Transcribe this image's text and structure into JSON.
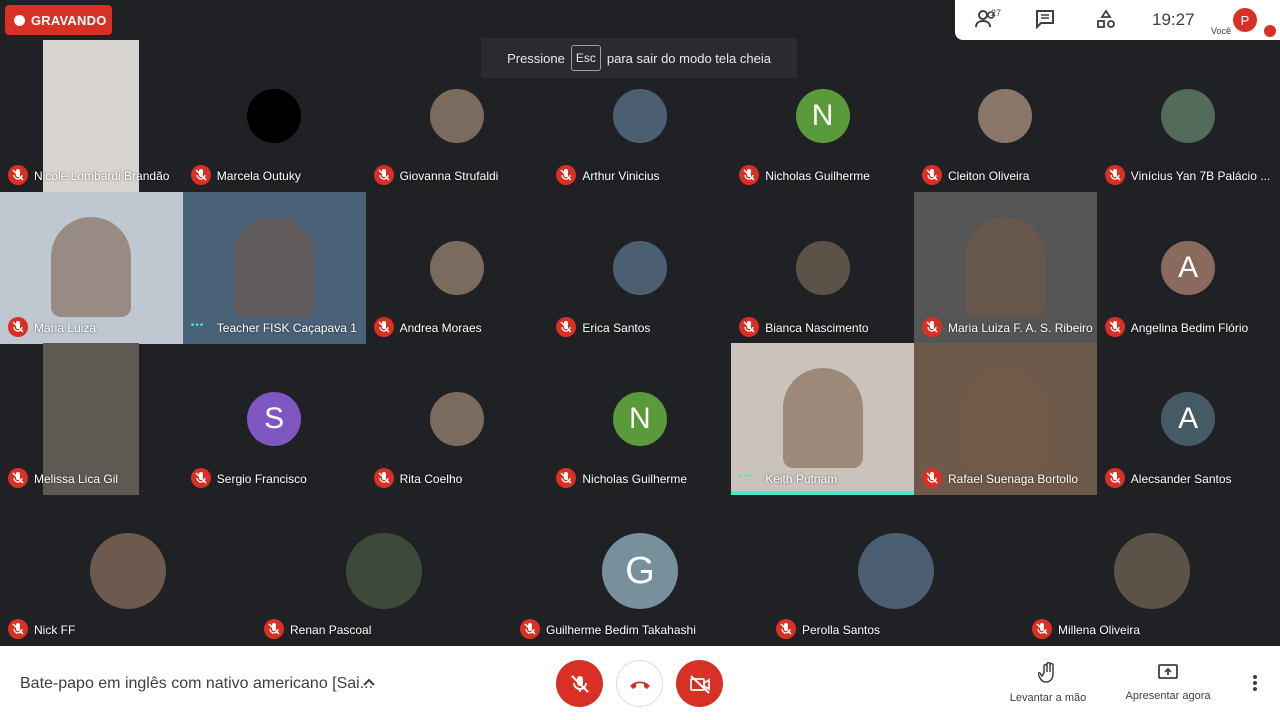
{
  "recording": {
    "label": "GRAVANDO"
  },
  "topbar": {
    "participants_count": "27",
    "time": "19:27",
    "self_initial": "P",
    "self_label": "Você"
  },
  "toast": {
    "before": "Pressione",
    "key": "Esc",
    "after": "para sair do modo tela cheia"
  },
  "participants": [
    {
      "name": "Nicole Lombardi Brandão",
      "icon": "video-thumbnail",
      "mic_muted": true
    },
    {
      "name": "Marcela Outuky",
      "icon": "avatar-black",
      "mic_muted": true
    },
    {
      "name": "Giovanna Strufaldi",
      "icon": "photo-avatar",
      "mic_muted": true
    },
    {
      "name": "Arthur Vinicius",
      "icon": "photo-avatar",
      "mic_muted": true
    },
    {
      "name": "Nicholas Guilherme",
      "initial": "N",
      "color": "#5b9a3a",
      "mic_muted": true
    },
    {
      "name": "Cleiton Oliveira",
      "icon": "photo-avatar",
      "mic_muted": true
    },
    {
      "name": "Vinícius Yan 7B Palácio ...",
      "icon": "photo-avatar",
      "mic_muted": true
    },
    {
      "name": "Maria Luiza",
      "icon": "video-feed",
      "mic_muted": true
    },
    {
      "name": "Teacher FISK Caçapava 1",
      "icon": "video-feed",
      "mic_muted": false
    },
    {
      "name": "Andrea Moraes",
      "icon": "photo-avatar",
      "mic_muted": true
    },
    {
      "name": "Erica Santos",
      "icon": "photo-avatar",
      "mic_muted": true
    },
    {
      "name": "Bianca Nascimento",
      "icon": "photo-avatar",
      "mic_muted": true
    },
    {
      "name": "Maria Luiza F. A. S. Ribeiro",
      "icon": "video-feed",
      "mic_muted": true
    },
    {
      "name": "Angelina Bedim Flório",
      "initial": "A",
      "color": "#8a6a5f",
      "mic_muted": true
    },
    {
      "name": "Melissa Lica Gil",
      "icon": "video-thumbnail",
      "mic_muted": true
    },
    {
      "name": "Sergio Francisco",
      "initial": "S",
      "color": "#7e57c2",
      "mic_muted": true
    },
    {
      "name": "Rita Coelho",
      "icon": "photo-avatar",
      "mic_muted": true
    },
    {
      "name": "Nicholas Guilherme",
      "initial": "N",
      "color": "#5b9a3a",
      "mic_muted": true
    },
    {
      "name": "Keith Putnam",
      "icon": "video-feed",
      "mic_muted": false,
      "speaking": true
    },
    {
      "name": "Rafael Suenaga Bortollo",
      "icon": "video-feed",
      "mic_muted": true
    },
    {
      "name": "Alecsander Santos",
      "initial": "A",
      "color": "#455a64",
      "mic_muted": true
    },
    {
      "name": "Nick FF",
      "icon": "photo-avatar",
      "mic_muted": true
    },
    {
      "name": "Renan Pascoal",
      "icon": "photo-avatar",
      "mic_muted": true
    },
    {
      "name": "Guilherme Bedim Takahashi",
      "initial": "G",
      "color": "#78909c",
      "mic_muted": true
    },
    {
      "name": "Perolla Santos",
      "icon": "photo-avatar",
      "mic_muted": true
    },
    {
      "name": "Millena Oliveira",
      "icon": "photo-avatar",
      "mic_muted": true
    }
  ],
  "bottom": {
    "meeting_title": "Bate-papo em inglês com nativo americano [Sai...",
    "raise_hand": "Levantar a mão",
    "present": "Apresentar agora"
  },
  "colors": {
    "red": "#d93025",
    "speaking": "#4ae8c6",
    "background": "#202124"
  }
}
